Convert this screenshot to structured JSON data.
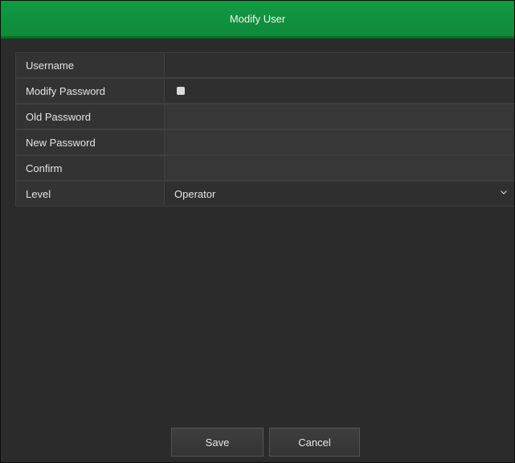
{
  "window": {
    "title": "Modify User"
  },
  "fields": {
    "username": {
      "label": "Username",
      "value": ""
    },
    "modify_password": {
      "label": "Modify Password",
      "checked": false
    },
    "old_password": {
      "label": "Old Password",
      "value": ""
    },
    "new_password": {
      "label": "New Password",
      "value": ""
    },
    "confirm": {
      "label": "Confirm",
      "value": ""
    },
    "level": {
      "label": "Level",
      "selected": "Operator"
    }
  },
  "buttons": {
    "save_label": "Save",
    "cancel_label": "Cancel"
  },
  "icons": {
    "checkbox": "checkbox-icon",
    "dropdown": "chevron-down-icon"
  },
  "colors": {
    "titlebar": "#0f8a3a",
    "background": "#2b2b2b"
  }
}
